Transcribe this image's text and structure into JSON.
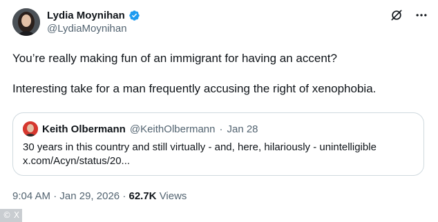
{
  "author": {
    "name": "Lydia Moynihan",
    "handle": "@LydiaMoynihan",
    "verified": true
  },
  "icons": {
    "verified": "verified-badge-icon",
    "grok": "grok-icon",
    "more": "more-icon"
  },
  "tweet": {
    "paragraphs": [
      "You’re really making fun of an immigrant for having an accent?",
      "Interesting take for a man frequently accusing the right of xenophobia."
    ]
  },
  "quote": {
    "name": "Keith Olbermann",
    "handle": "@KeithOlbermann",
    "separator": "·",
    "date": "Jan 28",
    "text_line1": "30 years in this country and still virtually - and, here, hilariously - unintelligible",
    "text_line2": "x.com/Acyn/status/20..."
  },
  "meta": {
    "time": "9:04 AM",
    "separator": "·",
    "date": "Jan 29, 2026",
    "views_count": "62.7K",
    "views_label": "Views"
  },
  "watermark": "© X",
  "colors": {
    "verified_blue": "#1d9bf0",
    "text_primary": "#0f1419",
    "text_secondary": "#536471",
    "border": "#cfd9de"
  }
}
